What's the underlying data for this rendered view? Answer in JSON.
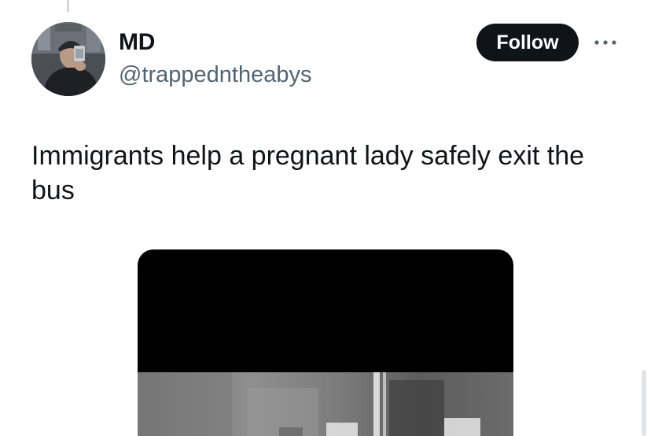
{
  "tweet": {
    "author": {
      "name": "MD",
      "handle": "@trappedntheabys"
    },
    "follow_label": "Follow",
    "text": "Immigrants help a pregnant lady safely exit the bus"
  },
  "icons": {
    "more": "more-horizontal-icon",
    "avatar": "profile-photo"
  },
  "colors": {
    "text_primary": "#0f1419",
    "text_secondary": "#536471",
    "follow_bg": "#0f1419",
    "follow_text": "#ffffff"
  }
}
